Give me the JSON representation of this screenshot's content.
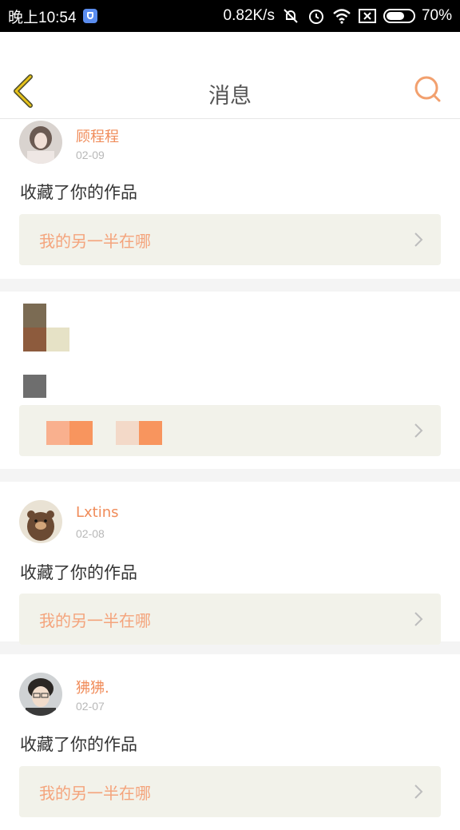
{
  "status_bar": {
    "time": "晚上10:54",
    "speed": "0.82K/s",
    "battery": "70%",
    "battery_level": 0.7
  },
  "header": {
    "title": "消息"
  },
  "messages": [
    {
      "username": "顾程程",
      "date": "02-09",
      "action": "收藏了你的作品",
      "work_title": "我的另一半在哪"
    },
    {
      "username": "",
      "date": "",
      "action": "",
      "work_title": ""
    },
    {
      "username": "Lxtins",
      "date": "02-08",
      "action": "收藏了你的作品",
      "work_title": "我的另一半在哪"
    },
    {
      "username": "狒狒.",
      "date": "02-07",
      "action": "收藏了你的作品",
      "work_title": "我的另一半在哪"
    }
  ],
  "colors": {
    "accent": "#f08c5a",
    "link_bg": "#f2f2ea",
    "back_arrow": "#e6c21a"
  }
}
